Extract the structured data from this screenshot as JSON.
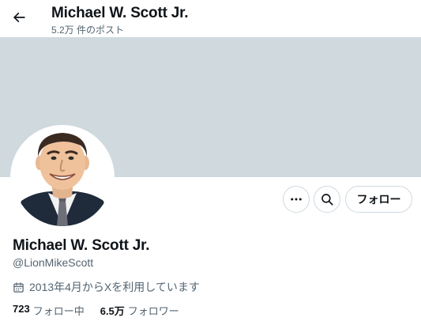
{
  "header": {
    "title": "Michael W. Scott Jr.",
    "post_count": "5.2万 件のポスト",
    "back_icon": "arrow-left-icon"
  },
  "profile": {
    "name": "Michael W. Scott Jr.",
    "handle": "@LionMikeScott",
    "joined": "2013年4月からXを利用しています",
    "joined_icon": "calendar-icon",
    "banner_color": "#cfd9de"
  },
  "actions": {
    "more_icon": "more-icon",
    "search_icon": "search-icon",
    "follow_label": "フォロー"
  },
  "stats": {
    "following_count": "723",
    "following_label": "フォロー中",
    "followers_count": "6.5万",
    "followers_label": "フォロワー"
  }
}
